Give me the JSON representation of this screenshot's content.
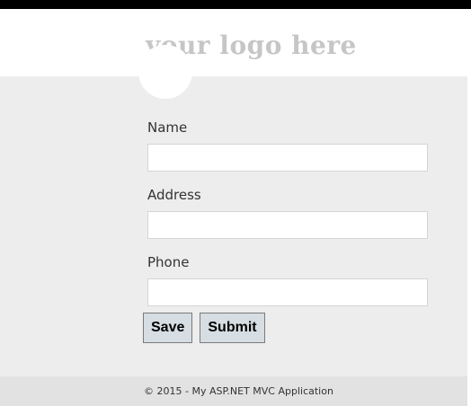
{
  "header": {
    "logo_text": "your logo here"
  },
  "form": {
    "fields": [
      {
        "label": "Name",
        "value": ""
      },
      {
        "label": "Address",
        "value": ""
      },
      {
        "label": "Phone",
        "value": ""
      }
    ],
    "buttons": {
      "save_label": "Save",
      "submit_label": "Submit"
    }
  },
  "footer": {
    "text": "© 2015 - My ASP.NET MVC Application"
  },
  "colors": {
    "page_background": "#ededed",
    "header_background": "#ffffff",
    "logo_text": "#c6c6c6",
    "button_background": "#d6dde3",
    "footer_background": "#e2e2e2"
  }
}
